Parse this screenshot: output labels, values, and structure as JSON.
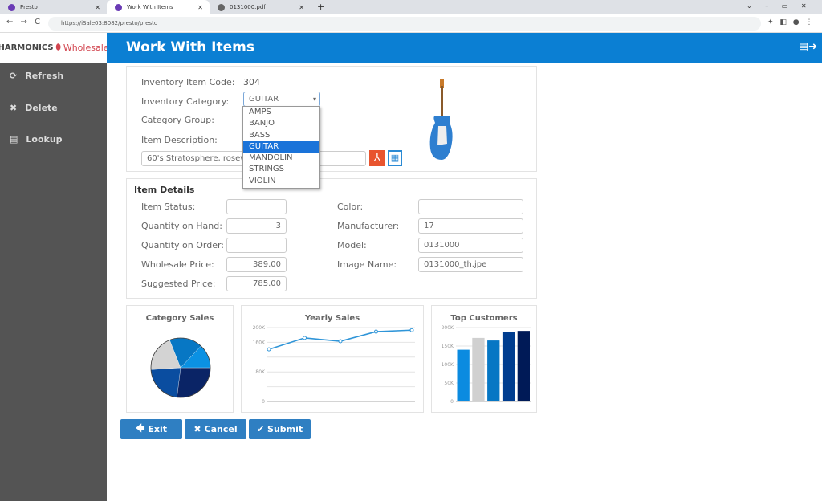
{
  "browser": {
    "tabs": [
      {
        "label": "Presto"
      },
      {
        "label": "Work With Items"
      },
      {
        "label": "0131000.pdf"
      }
    ],
    "url": "https://iSale03:8082/presto/presto"
  },
  "logo": {
    "left": "Harmonics",
    "right": "Wholesale"
  },
  "sidebar": {
    "items": [
      {
        "label": "Refresh",
        "icon": "refresh-icon"
      },
      {
        "label": "Delete",
        "icon": "close-icon"
      },
      {
        "label": "Lookup",
        "icon": "list-icon"
      }
    ]
  },
  "header": {
    "title": "Work With Items"
  },
  "form": {
    "item_code_label": "Inventory Item Code:",
    "item_code": "304",
    "category_label": "Inventory Category:",
    "category": "GUITAR",
    "category_options": [
      "AMPS",
      "BANJO",
      "BASS",
      "GUITAR",
      "MANDOLIN",
      "STRINGS",
      "VIOLIN"
    ],
    "group_label": "Category Group:",
    "desc_label": "Item Description:",
    "description": "60's Stratosphere, rosewood"
  },
  "details": {
    "title": "Item Details",
    "left": [
      {
        "label": "Item Status:",
        "value": ""
      },
      {
        "label": "Quantity on Hand:",
        "value": "3"
      },
      {
        "label": "Quantity on Order:",
        "value": ""
      },
      {
        "label": "Wholesale Price:",
        "value": "389.00"
      },
      {
        "label": "Suggested Price:",
        "value": "785.00"
      }
    ],
    "right": [
      {
        "label": "Color:",
        "value": ""
      },
      {
        "label": "Manufacturer:",
        "value": "17"
      },
      {
        "label": "Model:",
        "value": "0131000"
      },
      {
        "label": "Image Name:",
        "value": "0131000_th.jpe"
      }
    ]
  },
  "chart_data": [
    {
      "type": "pie",
      "title": "Category Sales",
      "values": [
        27,
        22,
        20,
        18,
        13
      ],
      "colors": [
        "#0a2466",
        "#0a4da0",
        "#d3d3d3",
        "#0777c4",
        "#0b91e3"
      ]
    },
    {
      "type": "line",
      "title": "Yearly Sales",
      "y_ticks": [
        "200K",
        "160K",
        "80K",
        "0"
      ],
      "ylim": [
        0,
        200000
      ],
      "values": [
        141000,
        172000,
        163000,
        189000,
        193000
      ],
      "color": "#2f95d8",
      "grid": true
    },
    {
      "type": "bar",
      "title": "Top Customers",
      "y_ticks": [
        "200K",
        "150K",
        "100K",
        "50K",
        "0"
      ],
      "ylim": [
        0,
        200000
      ],
      "values": [
        140000,
        172000,
        165000,
        188000,
        191000
      ],
      "colors": [
        "#0b8be0",
        "#d0d0d0",
        "#0777c4",
        "#003d8f",
        "#001a57"
      ],
      "grid": true
    }
  ],
  "buttons": {
    "exit": "Exit",
    "cancel": "Cancel",
    "submit": "Submit"
  }
}
